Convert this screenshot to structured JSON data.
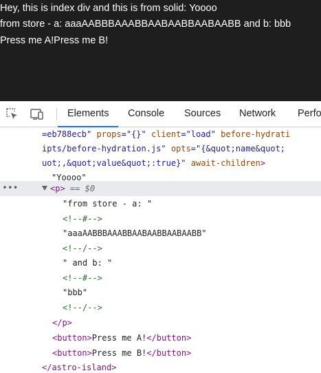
{
  "preview": {
    "line1": "Hey, this is index div and this is from solid: Yoooo",
    "line2": "from store - a: aaaAABBBAAABBAABAABBAABAABB and b: bbb",
    "button_a": "Press me A!",
    "button_b": "Press me B!"
  },
  "toolbar": {
    "tabs": [
      "Elements",
      "Console",
      "Sources",
      "Network",
      "Perfo"
    ],
    "active_tab": "Elements"
  },
  "tree": {
    "row1": {
      "p1": "=eb788ecb\"",
      "p2": " props",
      "p3": "=\"{}\"",
      "p4": " client",
      "p5": "=\"load\"",
      "p6": " before-hydrati"
    },
    "row2": {
      "p1": "ipts/before-hydration.js\"",
      "p2": " opts",
      "p3": "=\"{&quot;name&quot;"
    },
    "row3": {
      "p1": "uot;,&quot;value&quot;:true}\"",
      "p2": " await-children",
      "p3": ">"
    },
    "row4": {
      "text": "\"Yoooo\""
    },
    "row5": {
      "tag": "<p>",
      "eq": " == ",
      "ref": "$0",
      "dots": "•••"
    },
    "row6": {
      "text": "\"from store - a: \""
    },
    "row7": {
      "text": "<!--#-->"
    },
    "row8": {
      "text": "\"aaaAABBBAAABBAABAABBAABAABB\""
    },
    "row9": {
      "text": "<!--/-->"
    },
    "row10": {
      "text": "\" and b: \""
    },
    "row11": {
      "text": "<!--#-->"
    },
    "row12": {
      "text": "\"bbb\""
    },
    "row13": {
      "text": "<!--/-->"
    },
    "row14": {
      "text": "</p>"
    },
    "row15": {
      "open": "<button>",
      "text": "Press me A!",
      "close": "</button>"
    },
    "row16": {
      "open": "<button>",
      "text": "Press me B!",
      "close": "</button>"
    },
    "row17": {
      "text": "</astro-island>"
    }
  },
  "colors": {
    "preview_bg": "#1e1e1f",
    "tab_underline": "#1a73e8",
    "tag": "#881280",
    "attr_name": "#994500",
    "attr_value": "#1a1aa6",
    "comment": "#236e25",
    "selected_row": "#e8eaed"
  }
}
